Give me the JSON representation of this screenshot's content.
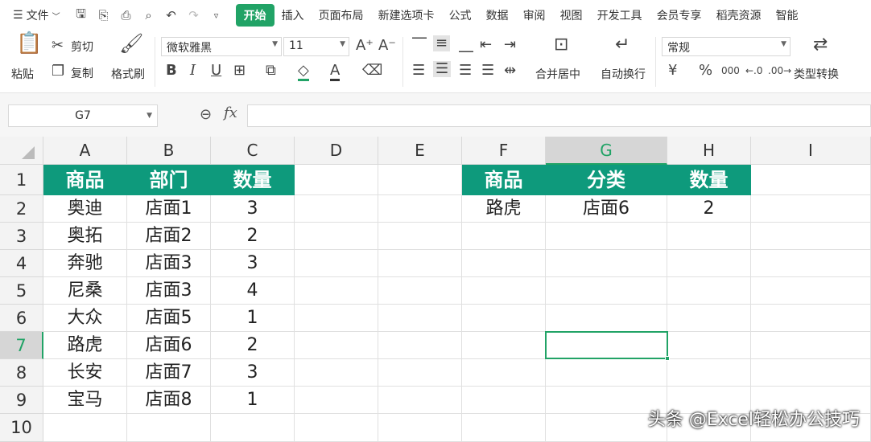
{
  "menubar": {
    "file_label": "文件",
    "tabs": [
      "开始",
      "插入",
      "页面布局",
      "新建选项卡",
      "公式",
      "数据",
      "审阅",
      "视图",
      "开发工具",
      "会员专享",
      "稻壳资源",
      "智能"
    ],
    "active_tab": "开始"
  },
  "ribbon": {
    "paste_label": "粘贴",
    "cut_label": "剪切",
    "copy_label": "复制",
    "format_painter_label": "格式刷",
    "font_name": "微软雅黑",
    "font_size": "11",
    "merge_label": "合并居中",
    "wrap_label": "自动换行",
    "number_format": "常规",
    "type_convert_label": "类型转换",
    "percent_symbol": "%",
    "thousands_symbol": "000",
    "currency_symbol": "¥"
  },
  "formula_bar": {
    "name_box": "G7",
    "fx_label": "fx",
    "formula": ""
  },
  "sheet": {
    "columns": [
      "A",
      "B",
      "C",
      "D",
      "E",
      "F",
      "G",
      "H",
      "I"
    ],
    "rows": [
      "1",
      "2",
      "3",
      "4",
      "5",
      "6",
      "7",
      "8",
      "9",
      "10"
    ],
    "selected_cell": "G7",
    "table1": {
      "headers": [
        "商品",
        "部门",
        "数量"
      ],
      "rows": [
        [
          "奥迪",
          "店面1",
          "3"
        ],
        [
          "奥拓",
          "店面2",
          "2"
        ],
        [
          "奔驰",
          "店面3",
          "3"
        ],
        [
          "尼桑",
          "店面3",
          "4"
        ],
        [
          "大众",
          "店面5",
          "1"
        ],
        [
          "路虎",
          "店面6",
          "2"
        ],
        [
          "长安",
          "店面7",
          "3"
        ],
        [
          "宝马",
          "店面8",
          "1"
        ]
      ]
    },
    "table2": {
      "headers": [
        "商品",
        "分类",
        "数量"
      ],
      "rows": [
        [
          "路虎",
          "店面6",
          "2"
        ]
      ]
    }
  },
  "watermark": "头条 @Excel轻松办公技巧",
  "colors": {
    "accent": "#21a366",
    "header_fill": "#0e9a7c"
  }
}
